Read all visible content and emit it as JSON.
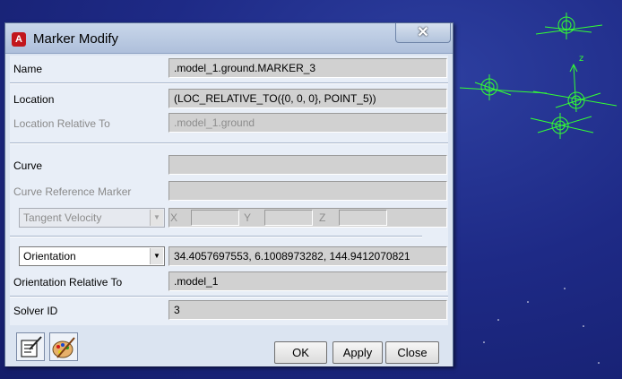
{
  "window": {
    "title": "Marker Modify",
    "app_icon_letter": "A",
    "close_glyph": "✕"
  },
  "fields": {
    "name_label": "Name",
    "name_value": ".model_1.ground.MARKER_3",
    "location_label": "Location",
    "location_value": "(LOC_RELATIVE_TO({0, 0, 0}, POINT_5))",
    "location_rel_label": "Location Relative To",
    "location_rel_value": ".model_1.ground",
    "curve_label": "Curve",
    "curve_value": "",
    "curve_ref_label": "Curve Reference Marker",
    "curve_ref_value": "",
    "tangent_select": "Tangent Velocity",
    "x_label": "X",
    "y_label": "Y",
    "z_label": "Z",
    "orientation_select": "Orientation",
    "orientation_value": "34.4057697553, 6.1008973282, 144.9412070821",
    "orientation_rel_label": "Orientation Relative To",
    "orientation_rel_value": ".model_1",
    "solver_label": "Solver ID",
    "solver_value": "3"
  },
  "buttons": {
    "ok": "OK",
    "apply": "Apply",
    "close": "Close"
  },
  "viewport": {
    "axis_label": "z",
    "marker_color": "#33ff33"
  }
}
